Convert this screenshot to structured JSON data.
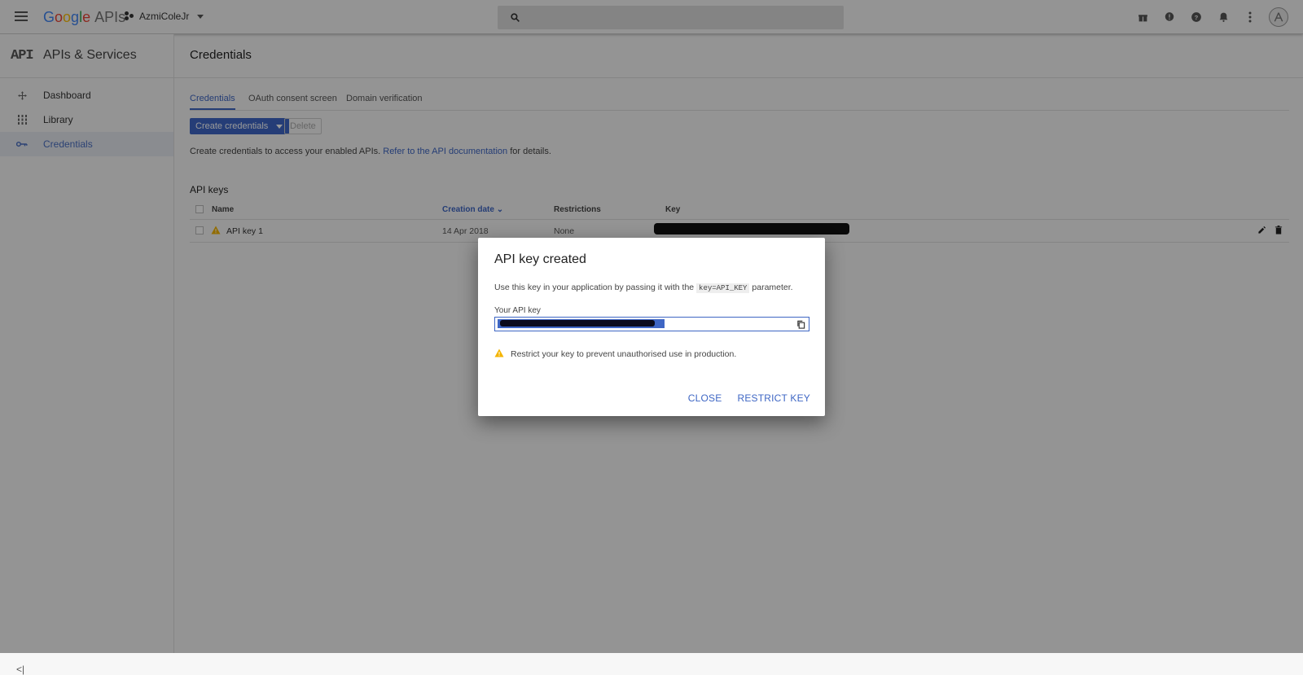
{
  "topbar": {
    "logo_google": [
      "G",
      "o",
      "o",
      "g",
      "l",
      "e"
    ],
    "logo_apis": "APIs",
    "project_name": "AzmiColeJr",
    "icons": [
      "gift-icon",
      "chat-icon",
      "help-icon",
      "notifications-icon",
      "more-vert-icon",
      "avatar-icon"
    ]
  },
  "sidebar": {
    "logo": "API",
    "title": "APIs & Services",
    "items": [
      {
        "label": "Dashboard",
        "icon": "dashboard-icon",
        "active": false
      },
      {
        "label": "Library",
        "icon": "library-icon",
        "active": false
      },
      {
        "label": "Credentials",
        "icon": "key-icon",
        "active": true
      }
    ],
    "collapse_label": "<|"
  },
  "main": {
    "title": "Credentials",
    "tabs": [
      "Credentials",
      "OAuth consent screen",
      "Domain verification"
    ],
    "create_button": "Create credentials",
    "delete_button": "Delete",
    "intro_text": "Create credentials to access your enabled APIs.",
    "intro_link": "Refer to the API documentation",
    "intro_suffix": "for details.",
    "section_title": "API keys",
    "table": {
      "columns": [
        "Name",
        "Creation date",
        "Restrictions",
        "Key"
      ],
      "rows": [
        {
          "name": "API key 1",
          "created": "14 Apr 2018",
          "restrictions": "None",
          "key": ""
        }
      ]
    }
  },
  "dialog": {
    "title": "API key created",
    "text_before": "Use this key in your application by passing it with the",
    "code": "key=API_KEY",
    "text_after": "parameter.",
    "field_label": "Your API key",
    "warning": "Restrict your key to prevent unauthorised use in production.",
    "close_label": "CLOSE",
    "restrict_label": "RESTRICT KEY"
  },
  "colors": {
    "accent": "#3e66c4",
    "warning": "#f4b400"
  }
}
